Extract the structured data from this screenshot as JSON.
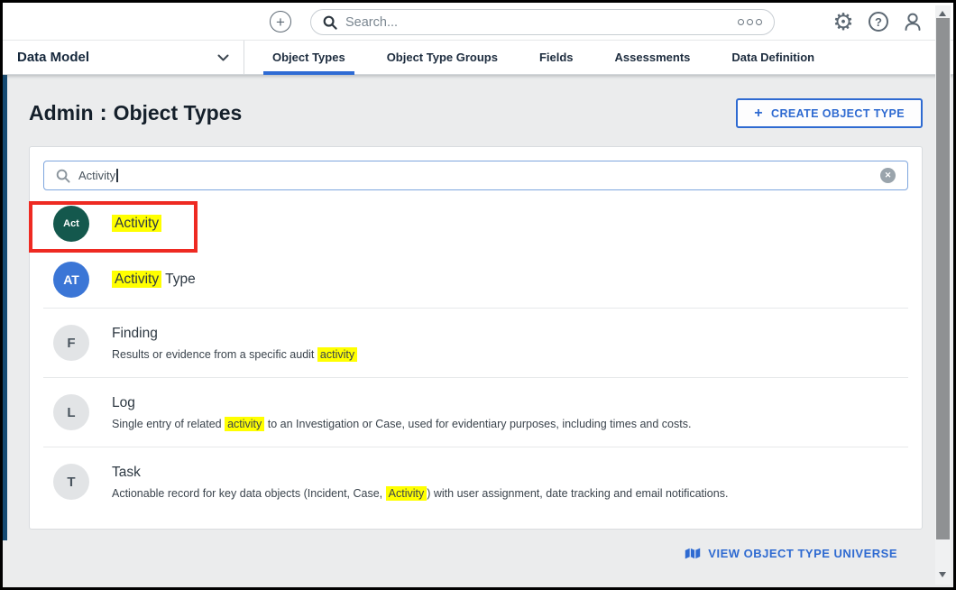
{
  "topbar": {
    "search": {
      "placeholder": "Search..."
    },
    "icons": {
      "add": "plus-circle-icon",
      "search": "magnifier-icon",
      "more": "kebab-horizontal-icon",
      "settings": "gear-icon",
      "help": "question-circle-icon",
      "account": "user-icon",
      "settings_glyph": "⚙",
      "help_glyph": "?"
    }
  },
  "navbar": {
    "context_label": "Data Model",
    "tabs": [
      {
        "label": "Object Types",
        "active": true
      },
      {
        "label": "Object Type Groups",
        "active": false
      },
      {
        "label": "Fields",
        "active": false
      },
      {
        "label": "Assessments",
        "active": false
      },
      {
        "label": "Data Definition",
        "active": false
      }
    ]
  },
  "page": {
    "title_prefix": "Admin",
    "title_separator": ":",
    "title": "Object Types",
    "create_button_icon": "+",
    "create_button_label": "CREATE OBJECT TYPE"
  },
  "object_search": {
    "value": "Activity",
    "clear_icon": "circle-x-icon",
    "clear_glyph": "✕"
  },
  "results": [
    {
      "initials": "Act",
      "avatar_bg": "#14584D",
      "avatar_fg": "#FFFFFF",
      "title": [
        {
          "text": "Activity",
          "highlight": true
        }
      ],
      "description": [],
      "annotated": true
    },
    {
      "initials": "AT",
      "avatar_bg": "#3B76D6",
      "avatar_fg": "#FFFFFF",
      "title": [
        {
          "text": "Activity",
          "highlight": true
        },
        {
          "text": " Type",
          "highlight": false
        }
      ],
      "description": []
    },
    {
      "initials": "F",
      "avatar_bg": "#E2E4E6",
      "avatar_fg": "#49545E",
      "title": [
        {
          "text": "Finding",
          "highlight": false
        }
      ],
      "description": [
        {
          "text": "Results or evidence from a specific audit ",
          "highlight": false
        },
        {
          "text": "activity",
          "highlight": true
        }
      ]
    },
    {
      "initials": "L",
      "avatar_bg": "#E2E4E6",
      "avatar_fg": "#49545E",
      "title": [
        {
          "text": "Log",
          "highlight": false
        }
      ],
      "description": [
        {
          "text": "Single entry of related ",
          "highlight": false
        },
        {
          "text": "activity",
          "highlight": true
        },
        {
          "text": " to an Investigation or Case, used for evidentiary purposes, including times and costs.",
          "highlight": false
        }
      ]
    },
    {
      "initials": "T",
      "avatar_bg": "#E2E4E6",
      "avatar_fg": "#49545E",
      "title": [
        {
          "text": "Task",
          "highlight": false
        }
      ],
      "description": [
        {
          "text": "Actionable record for key data objects (Incident, Case, ",
          "highlight": false
        },
        {
          "text": "Activity",
          "highlight": true
        },
        {
          "text": ") with user assignment, date tracking and email notifications.",
          "highlight": false
        }
      ]
    }
  ],
  "footer": {
    "view_universe_label": "VIEW OBJECT TYPE UNIVERSE",
    "view_universe_icon": "map-icon"
  },
  "colors": {
    "accent_blue": "#2E6BD4",
    "link_blue": "#2E6AD1",
    "highlight_yellow": "#FFFF00",
    "annotation_red": "#EE2A22",
    "content_border_navy": "#154A72",
    "teal_avatar": "#14584D",
    "blue_avatar": "#3B76D6",
    "gray_avatar": "#E2E4E6",
    "page_background": "#EBECED"
  }
}
